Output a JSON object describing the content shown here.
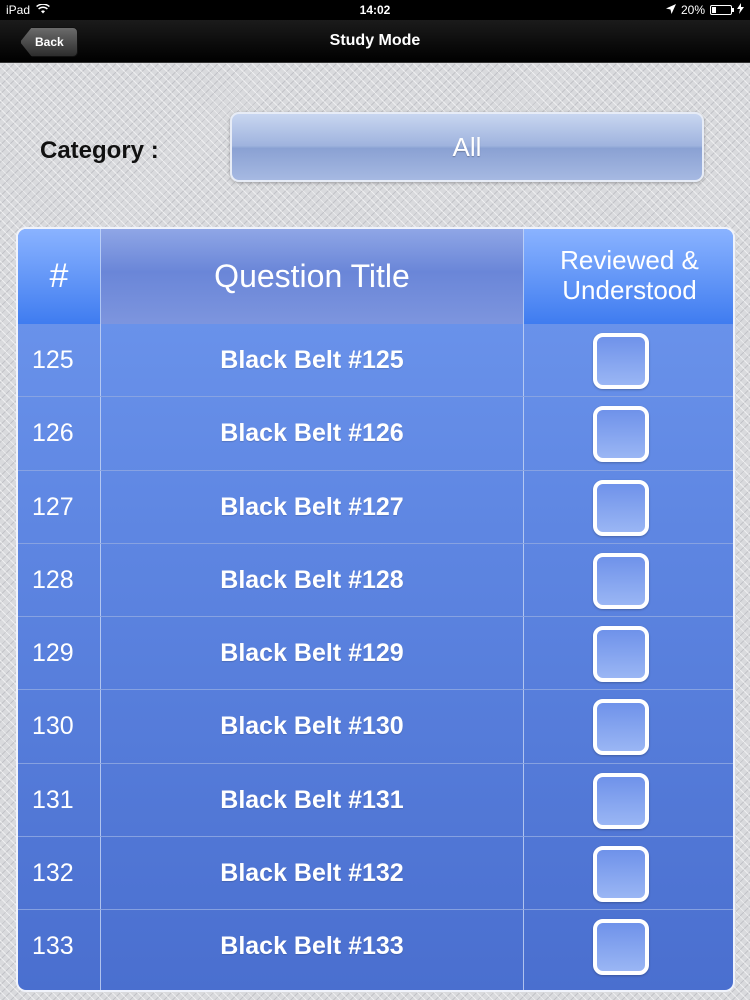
{
  "status_bar": {
    "device": "iPad",
    "time": "14:02",
    "battery": "20%",
    "battery_level": 0.2,
    "icons": [
      "wifi-icon",
      "location-arrow-icon",
      "battery-icon",
      "charging-bolt-icon"
    ]
  },
  "nav": {
    "back_label": "Back",
    "title": "Study Mode"
  },
  "category": {
    "label": "Category :",
    "value": "All"
  },
  "table": {
    "headers": {
      "number": "#",
      "title": "Question Title",
      "reviewed": "Reviewed & Understood"
    },
    "rows": [
      {
        "number": "125",
        "title": "Black Belt #125",
        "checked": false
      },
      {
        "number": "126",
        "title": "Black Belt #126",
        "checked": false
      },
      {
        "number": "127",
        "title": "Black Belt #127",
        "checked": false
      },
      {
        "number": "128",
        "title": "Black Belt #128",
        "checked": false
      },
      {
        "number": "129",
        "title": "Black Belt #129",
        "checked": false
      },
      {
        "number": "130",
        "title": "Black Belt #130",
        "checked": false
      },
      {
        "number": "131",
        "title": "Black Belt #131",
        "checked": false
      },
      {
        "number": "132",
        "title": "Black Belt #132",
        "checked": false
      },
      {
        "number": "133",
        "title": "Black Belt #133",
        "checked": false
      }
    ]
  },
  "colors": {
    "header_blue": "#3f7cf0",
    "panel_blue": "#5e86e2",
    "nav_black": "#000000"
  }
}
